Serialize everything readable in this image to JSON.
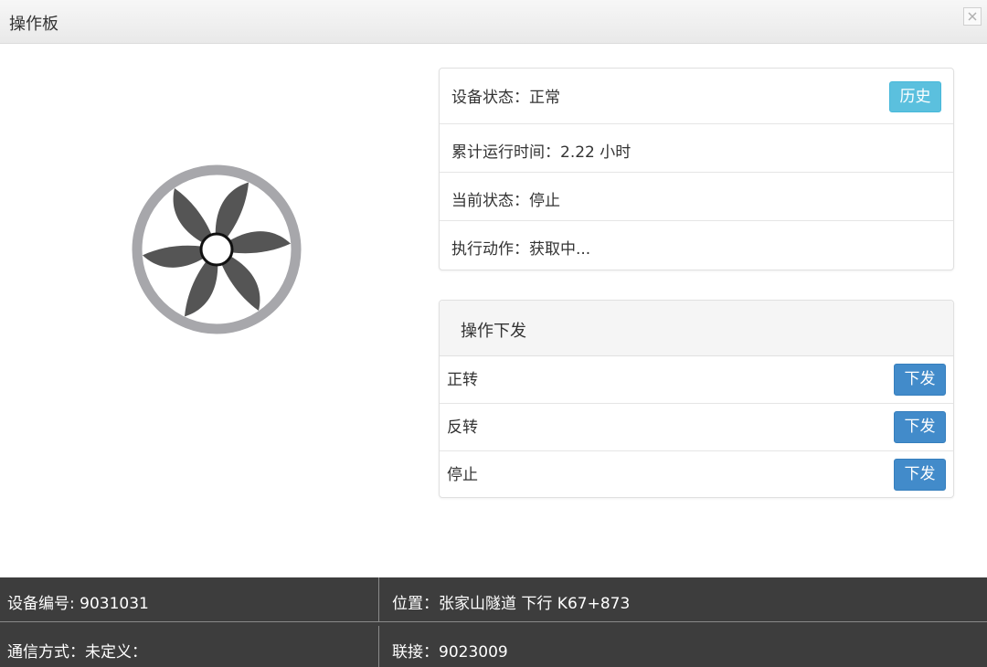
{
  "window": {
    "title": "操作板"
  },
  "device_status": {
    "status_label": "设备状态：",
    "status_value": "正常",
    "history_button": "历史",
    "runtime_label": "累计运行时间：",
    "runtime_value": "2.22 小时",
    "current_label": "当前状态：",
    "current_value": "停止",
    "action_label": "执行动作：",
    "action_value": "获取中..."
  },
  "operations": {
    "header": "操作下发",
    "items": [
      {
        "label": "正转",
        "button": "下发"
      },
      {
        "label": "反转",
        "button": "下发"
      },
      {
        "label": "停止",
        "button": "下发"
      }
    ]
  },
  "info": {
    "device_id_label": "设备编号:",
    "device_id_value": "9031031",
    "location_label": "位置：",
    "location_value": "张家山隧道 下行 K67+873",
    "comm_label": "通信方式：",
    "comm_value": "未定义：",
    "link_label": "联接：",
    "link_value": "9023009"
  },
  "colors": {
    "history_button": "#5bc0de",
    "send_button": "#428bca",
    "info_bar": "#3d3d3d",
    "fan_blade": "#555555",
    "fan_ring": "#a7a7ab"
  },
  "icons": {
    "close": "close-icon",
    "fan": "fan-icon"
  }
}
